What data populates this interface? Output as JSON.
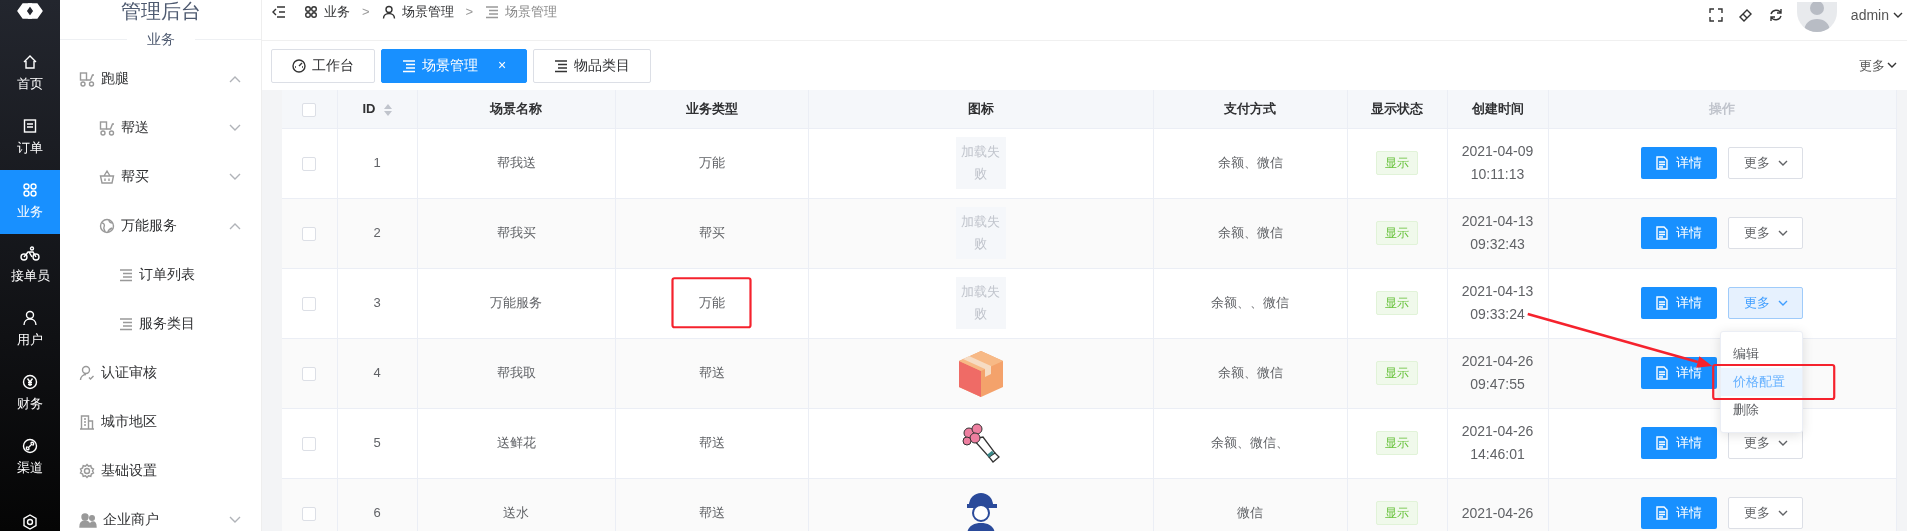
{
  "rail": {
    "items": [
      {
        "label": "首页",
        "selected": false
      },
      {
        "label": "订单",
        "selected": false
      },
      {
        "label": "业务",
        "selected": true
      },
      {
        "label": "接单员",
        "selected": false
      },
      {
        "label": "用户",
        "selected": false
      },
      {
        "label": "财务",
        "selected": false
      },
      {
        "label": "渠道",
        "selected": false
      },
      {
        "selected": false
      }
    ]
  },
  "sidebar": {
    "title": "管理后台",
    "section": "业务",
    "items": [
      {
        "label": "跑腿",
        "expanded": true,
        "children": [
          {
            "label": "帮送",
            "expanded": false
          },
          {
            "label": "帮买",
            "expanded": false
          },
          {
            "label": "万能服务",
            "expanded": true,
            "children": [
              {
                "label": "订单列表"
              },
              {
                "label": "服务类目"
              }
            ]
          }
        ]
      },
      {
        "label": "认证审核"
      },
      {
        "label": "城市地区"
      },
      {
        "label": "基础设置"
      },
      {
        "label": "企业商户",
        "expanded": false
      }
    ]
  },
  "breadcrumb": {
    "separator": ">",
    "items": [
      {
        "label": "业务",
        "current": false
      },
      {
        "label": "场景管理",
        "current": false
      },
      {
        "label": "场景管理",
        "current": true
      }
    ]
  },
  "user": {
    "name": "admin"
  },
  "tabs": [
    {
      "label": "工作台",
      "selected": false
    },
    {
      "label": "场景管理",
      "selected": true,
      "close": "×"
    },
    {
      "label": "物品类目",
      "selected": false
    }
  ],
  "tabs_more": "更多",
  "table": {
    "all_checked": false,
    "columns": [
      "ID",
      "场景名称",
      "业务类型",
      "图标",
      "支付方式",
      "显示状态",
      "创建时间",
      "操作"
    ],
    "rows": [
      {
        "checked": false,
        "id": "1",
        "name": "帮我送",
        "type": "万能",
        "icon": {
          "kind": "failed",
          "text": "加载失败"
        },
        "pay": "余额、微信",
        "status": "显示",
        "date": "2021-04-09",
        "time": "10:11:13",
        "detail": "详情",
        "more": "更多",
        "open": false
      },
      {
        "checked": false,
        "id": "2",
        "name": "帮我买",
        "type": "帮买",
        "icon": {
          "kind": "failed",
          "text": "加载失败"
        },
        "pay": "余额、微信",
        "status": "显示",
        "date": "2021-04-13",
        "time": "09:32:43",
        "detail": "详情",
        "more": "更多",
        "open": false
      },
      {
        "checked": false,
        "id": "3",
        "name": "万能服务",
        "type": "万能",
        "type_marked": true,
        "icon": {
          "kind": "failed",
          "text": "加载失败"
        },
        "pay": "余额、、微信",
        "status": "显示",
        "date": "2021-04-13",
        "time": "09:33:24",
        "detail": "详情",
        "more": "更多",
        "open": true,
        "arrow": true,
        "menu": [
          {
            "label": "编辑",
            "selected": false,
            "marked": false
          },
          {
            "label": "价格配置",
            "selected": true,
            "marked": true
          },
          {
            "label": "删除",
            "selected": false,
            "marked": false
          }
        ]
      },
      {
        "checked": false,
        "id": "4",
        "name": "帮我取",
        "type": "帮送",
        "icon": {
          "kind": "box"
        },
        "pay": "余额、微信",
        "status": "显示",
        "date": "2021-04-26",
        "time": "09:47:55",
        "detail": "详情"
      },
      {
        "checked": false,
        "id": "5",
        "name": "送鲜花",
        "type": "帮送",
        "icon": {
          "kind": "flowers"
        },
        "pay": "余额、微信、",
        "status": "显示",
        "date": "2021-04-26",
        "time": "14:46:01",
        "detail": "详情",
        "more": "更多",
        "open": false
      },
      {
        "checked": false,
        "id": "6",
        "name": "送水",
        "type": "帮送",
        "icon": {
          "kind": "courier"
        },
        "pay": "微信",
        "status": "显示",
        "date": "2021-04-26",
        "detail": "详情",
        "more": "更多",
        "open": false
      }
    ]
  }
}
